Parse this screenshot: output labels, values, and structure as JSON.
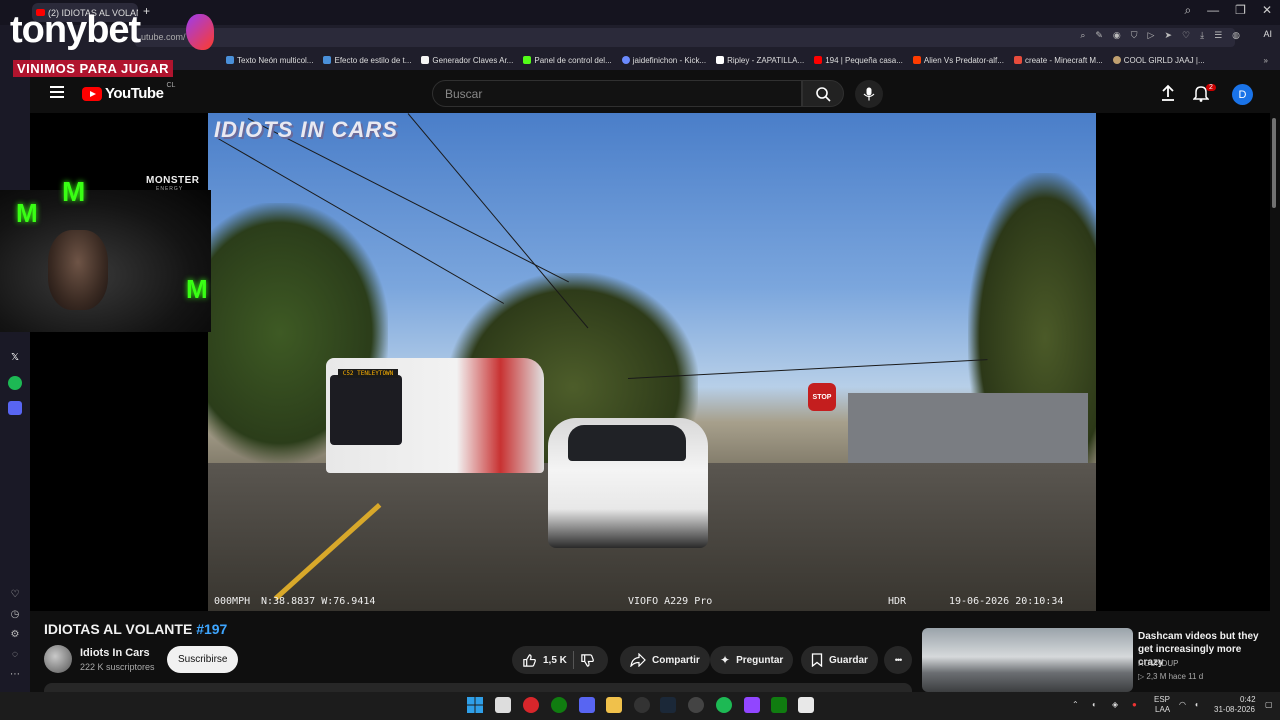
{
  "browser": {
    "tab_title": "(2) IDIOTAS AL VOLANTE",
    "new_tab": "+",
    "url_fragment": "utube.com/",
    "ai_label": "AI",
    "bookmarks": [
      "Texto Neón multicol...",
      "Efecto de estilo de t...",
      "Generador Claves Ar...",
      "Panel de control del...",
      "jaidefinichon - Kick...",
      "Ripley - ZAPATILLA...",
      "194 | Pequeña casa...",
      "Alien Vs Predator-alf...",
      "create - Minecraft M...",
      "COOL GIRLD JAAJ |..."
    ],
    "bookmark_colors": [
      "#3b82f6",
      "#3b82f6",
      "#f5f5f5",
      "#53fc18",
      "#6b8afd",
      "#ffffff",
      "#ff0000",
      "#ff3c00",
      "#e74c3c",
      "#c0a070"
    ]
  },
  "overlay": {
    "logo": "tonybet",
    "slogan": "VINIMOS PARA JUGAR",
    "monster_word": "MONSTER",
    "monster_sub": "ENERGY",
    "monster_claw": "M"
  },
  "youtube": {
    "logo_text": "YouTube",
    "country": "CL",
    "search_placeholder": "Buscar",
    "notification_count": "2",
    "avatar_letter": "D"
  },
  "video": {
    "overlay_title": "IDIOTS IN CARS",
    "bus_sign": "C52 TENLEYTOWN",
    "stop_sign": "STOP",
    "hud_speed": "000MPH",
    "hud_coords": "N:38.8837 W:76.9414",
    "hud_device": "VIOFO A229 Pro",
    "hud_hdr": "HDR",
    "hud_datetime": "19-06-2026 20:10:34"
  },
  "details": {
    "title": "IDIOTAS AL VOLANTE",
    "tag": "#197",
    "channel_name": "Idiots In Cars",
    "subscribers": "222 K suscriptores",
    "subscribe_label": "Suscribirse",
    "likes": "1,5 K",
    "share_label": "Compartir",
    "ask_label": "Preguntar",
    "save_label": "Guardar",
    "more_label": "•••"
  },
  "recommendation": {
    "title": "Dashcam videos but they get increasingly more crazy",
    "channel": "ROUNDUP",
    "meta": "▷ 2,3 M   hace 11 d"
  },
  "taskbar": {
    "lang": "ESP",
    "lang_sub": "LAA",
    "time": "0:42",
    "date": "31-08-2026"
  }
}
